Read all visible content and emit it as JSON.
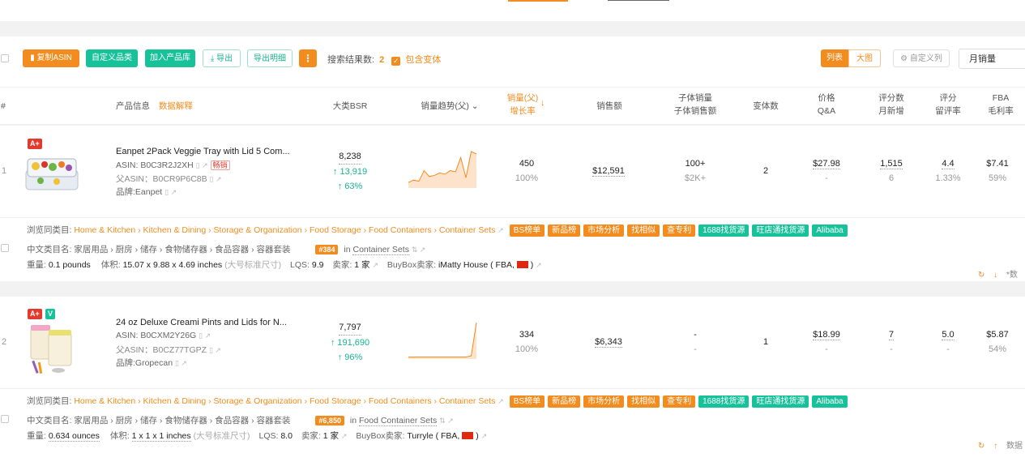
{
  "toolbar": {
    "copy_asin": "复制ASIN",
    "custom_category": "自定义品类",
    "add_to_library": "加入产品库",
    "export": "导出",
    "export_detail": "导出明细",
    "more": "⋮",
    "result_label": "搜索结果数:",
    "result_count": "2",
    "include_variants": "包含变体",
    "view_list": "列表",
    "view_grid": "大图",
    "custom_columns": "自定义列",
    "sort_select": "月销量"
  },
  "headers": {
    "index": "#",
    "product_info": "产品信息",
    "data_explain": "数据解释",
    "bsr": "大类BSR",
    "trend": "销量趋势(父)",
    "sales_a": "销量(父)",
    "sales_b": "增长率",
    "revenue": "销售额",
    "child_sales_a": "子体销量",
    "child_sales_b": "子体销售额",
    "variants": "变体数",
    "price_a": "价格",
    "price_b": "Q&A",
    "rating_count_a": "评分数",
    "rating_count_b": "月新增",
    "rating_a": "评分",
    "rating_b": "留评率",
    "fba_a": "FBA",
    "fba_b": "毛利率"
  },
  "products": [
    {
      "index": "1",
      "badge1": "A+",
      "title": "Eanpet 2Pack Veggie Tray with Lid 5 Com...",
      "asin": "ASIN: B0C3R2J2XH",
      "hot": "畅销",
      "parent_asin": "父ASIN：B0CR9P6C8B",
      "brand": "品牌:Eanpet",
      "bsr": "8,238",
      "bsr_change": "↑ 13,919",
      "bsr_pct": "↑ 63%",
      "sales": "450",
      "growth": "100%",
      "revenue": "$12,591",
      "child_sales": "100+",
      "child_revenue": "$2K+",
      "variants": "2",
      "price": "$27.98",
      "qa": "-",
      "ratings": "1,515",
      "ratings_new": "6",
      "score": "4.4",
      "review_rate": "1.33%",
      "fba": "$7.41",
      "margin": "59%",
      "trend": [
        4,
        6,
        5,
        14,
        9,
        10,
        12,
        11,
        14,
        13,
        25,
        8,
        30,
        28
      ],
      "browse_label": "浏览同类目:",
      "browse_path": "Home & Kitchen › Kitchen & Dining › Storage & Organization › Food Storage › Food Containers › Container Sets",
      "tags": [
        "BS榜单",
        "新品榜",
        "市场分析",
        "找相似",
        "查专利",
        "1688找货源",
        "旺店通找货源",
        "Alibaba"
      ],
      "cn_category": "中文类目名: 家居用品 › 厨房 › 储存 › 食物储存器 › 食品容器 › 容器套装",
      "rank": "#384",
      "rank_in": "in",
      "rank_cat": "Container Sets",
      "weight_label": "重量:",
      "weight": "0.1 pounds",
      "size_label": "体积:",
      "size": "15.07 x 9.88 x 4.69 inches",
      "size_type": "(大号标准尺寸)",
      "lqs_label": "LQS:",
      "lqs": "9.9",
      "sellers_label": "卖家:",
      "sellers": "1 家",
      "buybox_label": "BuyBox卖家:",
      "buybox_seller": "iMatty House ( FBA,",
      "buybox_end": ")",
      "foot_arrow": "↓",
      "foot_text": "*数"
    },
    {
      "index": "2",
      "badge1": "A+",
      "badge2": "V",
      "title": "24 oz Deluxe Creami Pints and Lids for N...",
      "asin": "ASIN: B0CXM2Y26G",
      "parent_asin": "父ASIN：B0CZ77TGPZ",
      "brand": "品牌:Gropecan",
      "bsr": "7,797",
      "bsr_change": "↑ 191,690",
      "bsr_pct": "↑ 96%",
      "sales": "334",
      "growth": "100%",
      "revenue": "$6,343",
      "child_sales": "-",
      "child_revenue": "-",
      "variants": "1",
      "price": "$18.99",
      "qa": "-",
      "ratings": "7",
      "ratings_new": "-",
      "score": "5.0",
      "review_rate": "-",
      "fba": "$5.87",
      "margin": "54%",
      "trend": [
        1,
        1,
        1,
        1,
        1,
        1,
        1,
        1,
        1,
        1,
        1,
        1,
        2,
        30
      ],
      "browse_label": "浏览同类目:",
      "browse_path": "Home & Kitchen › Kitchen & Dining › Storage & Organization › Food Storage › Food Containers › Container Sets",
      "tags": [
        "BS榜单",
        "新品榜",
        "市场分析",
        "找相似",
        "查专利",
        "1688找货源",
        "旺店通找货源",
        "Alibaba"
      ],
      "cn_category": "中文类目名: 家居用品 › 厨房 › 储存 › 食物储存器 › 食品容器 › 容器套装",
      "rank": "#6,850",
      "rank_in": "in",
      "rank_cat": "Food Container Sets",
      "weight_label": "重量:",
      "weight": "0.634 ounces",
      "size_label": "体积:",
      "size": "1 x 1 x 1 inches",
      "size_type": "(大号标准尺寸)",
      "lqs_label": "LQS:",
      "lqs": "8.0",
      "sellers_label": "卖家:",
      "sellers": "1 家",
      "buybox_label": "BuyBox卖家:",
      "buybox_seller": "Turryle ( FBA,",
      "buybox_end": ")",
      "foot_arrow": "↑",
      "foot_text": "数据"
    }
  ],
  "colors": {
    "orange": "#f28c1e",
    "green": "#17c19a"
  }
}
